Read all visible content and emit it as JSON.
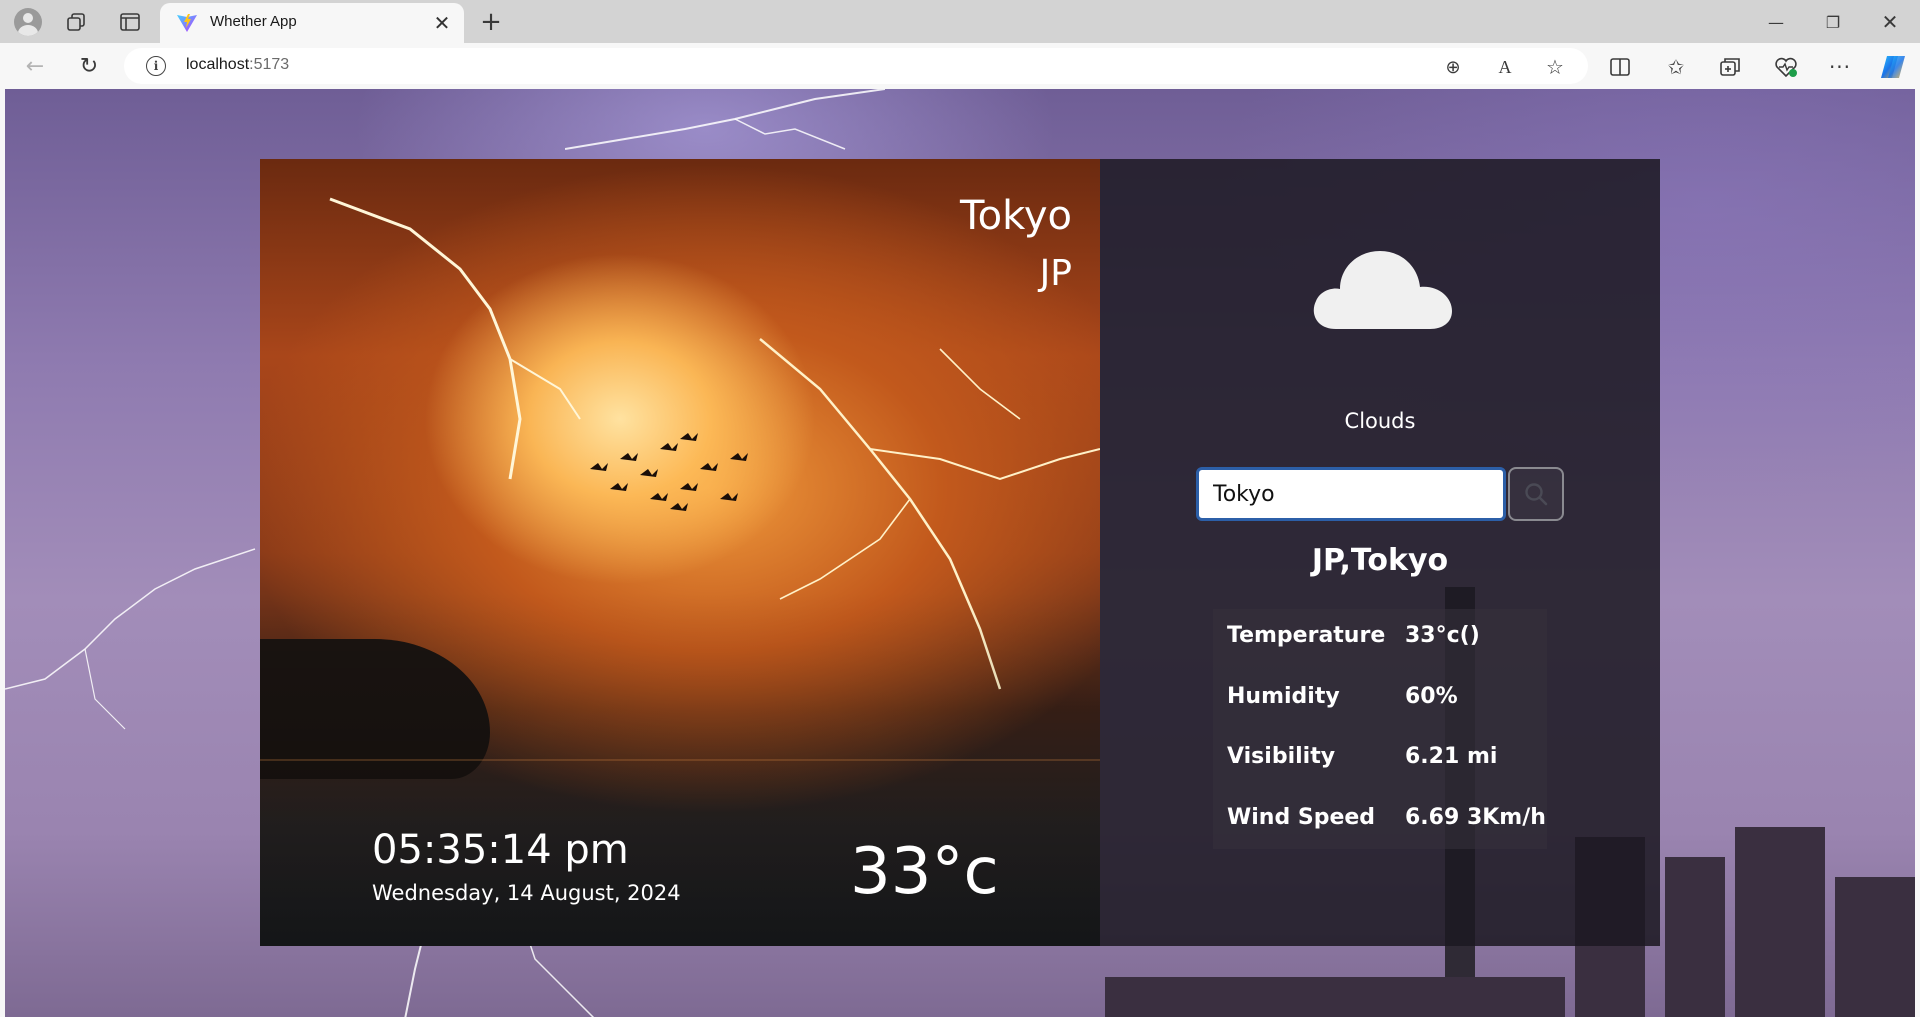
{
  "browser": {
    "tab_title": "Whether App",
    "url_host": "localhost",
    "url_port": ":5173",
    "icons": {
      "profile": "profile-icon",
      "workspaces": "collections-icon",
      "tab_actions": "tab-actions-icon",
      "close_tab": "close-icon",
      "new_tab": "plus-icon",
      "minimize": "minimize-icon",
      "maximize": "restore-icon",
      "close_window": "close-icon",
      "back": "back-arrow-icon",
      "refresh": "refresh-icon",
      "info": "info-icon",
      "zoom": "zoom-icon",
      "read_aloud": "read-aloud-icon",
      "favorite": "star-icon",
      "split_screen": "split-screen-icon",
      "favorites": "favorites-icon",
      "collections": "collections-icon",
      "browser_essentials": "heart-pulse-icon",
      "more": "more-icon",
      "copilot": "copilot-icon"
    },
    "glyphs": {
      "close": "✕",
      "plus": "+",
      "minimize": "—",
      "restore": "❐",
      "back": "←",
      "refresh": "↻",
      "info": "i",
      "zoom": "⊕",
      "read_aloud": "A",
      "favorite": "☆",
      "favorites": "✩",
      "health": "♡",
      "more": "···"
    }
  },
  "weather": {
    "city": "Tokyo",
    "country": "JP",
    "time": "05:35:14 pm",
    "date": "Wednesday, 14 August, 2024",
    "temperature_big": "33°c",
    "condition": "Clouds",
    "search_value": "Tokyo",
    "location_title": "JP,Tokyo",
    "details": [
      {
        "label": "Temperature",
        "value": "33°c()"
      },
      {
        "label": "Humidity",
        "value": "60%"
      },
      {
        "label": "Visibility",
        "value": "6.21 mi"
      },
      {
        "label": "Wind Speed",
        "value": "6.69 3Km/h"
      }
    ]
  },
  "colors": {
    "search_border": "#2c5fa8",
    "panel_dark": "#1c1822",
    "page_bg": "#8f7bb0"
  }
}
